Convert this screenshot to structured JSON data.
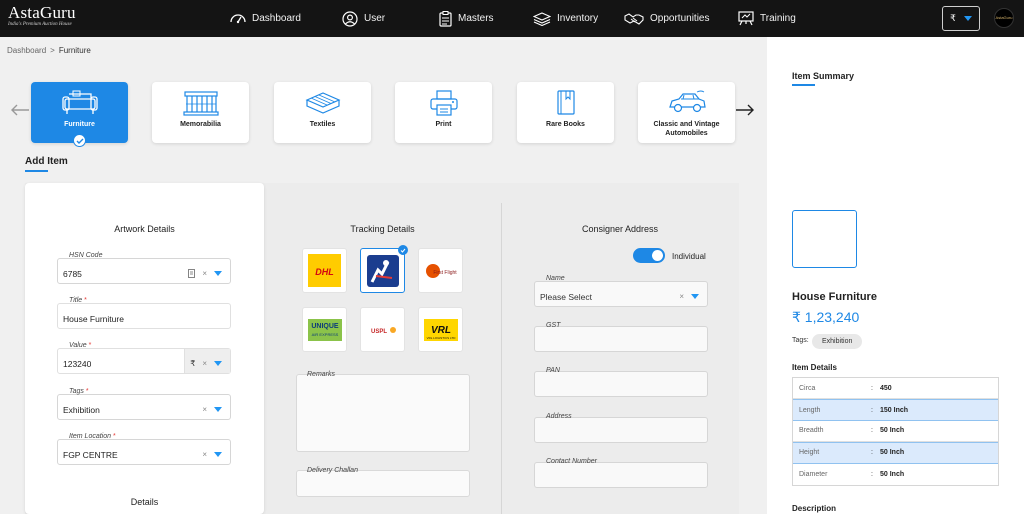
{
  "brand": {
    "name": "AstaGuru",
    "tagline": "India's Premium Auction House"
  },
  "nav": [
    {
      "label": "Dashboard",
      "icon": "dashboard-icon"
    },
    {
      "label": "User",
      "icon": "user-icon"
    },
    {
      "label": "Masters",
      "icon": "masters-icon"
    },
    {
      "label": "Inventory",
      "icon": "inventory-icon"
    },
    {
      "label": "Opportunities",
      "icon": "handshake-icon"
    },
    {
      "label": "Training",
      "icon": "training-icon"
    }
  ],
  "currency": {
    "symbol": "₹"
  },
  "avatar": {
    "text": "AstaGuru"
  },
  "breadcrumb": {
    "root": "Dashboard",
    "separator": ">",
    "current": "Furniture"
  },
  "categories": [
    {
      "label": "Furniture",
      "icon": "furniture-icon",
      "active": true
    },
    {
      "label": "Memorabilia",
      "icon": "memorabilia-icon"
    },
    {
      "label": "Textiles",
      "icon": "textiles-icon"
    },
    {
      "label": "Print",
      "icon": "printer-icon"
    },
    {
      "label": "Rare Books",
      "icon": "book-icon"
    },
    {
      "label": "Classic and Vintage Automobiles",
      "icon": "car-icon"
    }
  ],
  "add_item": {
    "title": "Add Item"
  },
  "artwork": {
    "title": "Artwork Details",
    "hsn": {
      "label": "HSN Code",
      "value": "6785"
    },
    "title_field": {
      "label": "Title",
      "value": "House Furniture"
    },
    "value_field": {
      "label": "Value",
      "value": "123240",
      "currency": "₹"
    },
    "tags": {
      "label": "Tags",
      "value": "Exhibition"
    },
    "location": {
      "label": "Item Location",
      "value": "FGP CENTRE"
    },
    "details_title": "Details"
  },
  "tracking": {
    "title": "Tracking Details",
    "logos": [
      {
        "name": "DHL",
        "label": "DHL"
      },
      {
        "name": "courier",
        "label": ""
      },
      {
        "name": "first-flight",
        "label": "First Flight"
      },
      {
        "name": "unique-air-express",
        "label": "UNIQUE AIR EXPRESS"
      },
      {
        "name": "uspl",
        "label": "USPL"
      },
      {
        "name": "vrl",
        "label": "VRL"
      }
    ],
    "remarks_label": "Remarks",
    "challan_label": "Delivery Challan"
  },
  "consigner": {
    "title": "Consigner Address",
    "toggle_label": "Individual",
    "name_label": "Name",
    "name_placeholder": "Please Select",
    "gst_label": "GST",
    "pan_label": "PAN",
    "address_label": "Address",
    "contact_label": "Contact Number"
  },
  "summary": {
    "title": "Item Summary",
    "item_name": "House Furniture",
    "price": "₹ 1,23,240",
    "tags_label": "Tags:",
    "tag": "Exhibition",
    "details_title": "Item Details",
    "details": [
      {
        "key": "Circa",
        "value": "450",
        "highlight": false
      },
      {
        "key": "Length",
        "value": "150 Inch",
        "highlight": true
      },
      {
        "key": "Breadth",
        "value": "50 Inch",
        "highlight": false
      },
      {
        "key": "Height",
        "value": "50 Inch",
        "highlight": true
      },
      {
        "key": "Diameter",
        "value": "50 Inch",
        "highlight": false
      }
    ],
    "description_title": "Description"
  },
  "colors": {
    "accent": "#1e88e5",
    "topbar": "#141414",
    "highlight_row": "#dbeafc"
  }
}
